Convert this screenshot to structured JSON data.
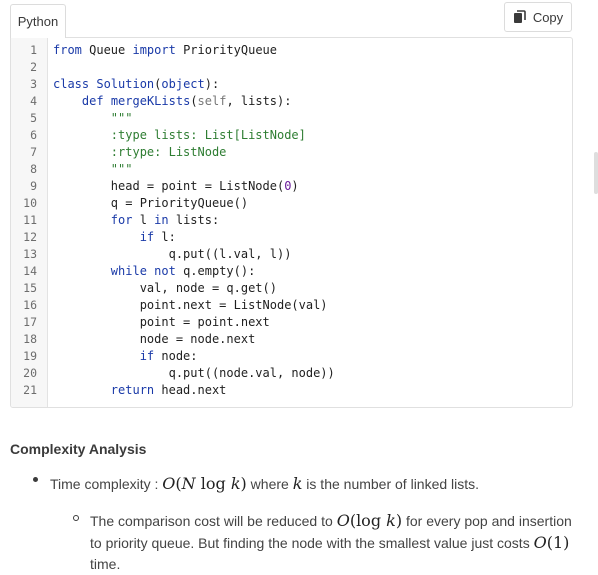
{
  "tab": {
    "label": "Python"
  },
  "copy": {
    "label": "Copy"
  },
  "code": {
    "line_numbers": [
      "1",
      "2",
      "3",
      "4",
      "5",
      "6",
      "7",
      "8",
      "9",
      "10",
      "11",
      "12",
      "13",
      "14",
      "15",
      "16",
      "17",
      "18",
      "19",
      "20",
      "21"
    ],
    "lines": [
      [
        {
          "t": "from",
          "c": "kw"
        },
        {
          "t": " Queue "
        },
        {
          "t": "import",
          "c": "kw"
        },
        {
          "t": " PriorityQueue"
        }
      ],
      [],
      [
        {
          "t": "class",
          "c": "kw"
        },
        {
          "t": " "
        },
        {
          "t": "Solution",
          "c": "kw"
        },
        {
          "t": "("
        },
        {
          "t": "object",
          "c": "kw"
        },
        {
          "t": "):"
        }
      ],
      [
        {
          "t": "    "
        },
        {
          "t": "def",
          "c": "kw"
        },
        {
          "t": " "
        },
        {
          "t": "mergeKLists",
          "c": "kw"
        },
        {
          "t": "("
        },
        {
          "t": "self",
          "c": "slf"
        },
        {
          "t": ", lists):"
        }
      ],
      [
        {
          "t": "        "
        },
        {
          "t": "\"\"\"",
          "c": "str"
        }
      ],
      [
        {
          "t": "        "
        },
        {
          "t": ":type lists: List[ListNode]",
          "c": "str"
        }
      ],
      [
        {
          "t": "        "
        },
        {
          "t": ":rtype: ListNode",
          "c": "str"
        }
      ],
      [
        {
          "t": "        "
        },
        {
          "t": "\"\"\"",
          "c": "str"
        }
      ],
      [
        {
          "t": "        head = point = ListNode("
        },
        {
          "t": "0",
          "c": "num"
        },
        {
          "t": ")"
        }
      ],
      [
        {
          "t": "        q = PriorityQueue()"
        }
      ],
      [
        {
          "t": "        "
        },
        {
          "t": "for",
          "c": "kw"
        },
        {
          "t": " l "
        },
        {
          "t": "in",
          "c": "kw"
        },
        {
          "t": " lists:"
        }
      ],
      [
        {
          "t": "            "
        },
        {
          "t": "if",
          "c": "kw"
        },
        {
          "t": " l:"
        }
      ],
      [
        {
          "t": "                q.put((l.val, l))"
        }
      ],
      [
        {
          "t": "        "
        },
        {
          "t": "while",
          "c": "kw"
        },
        {
          "t": " "
        },
        {
          "t": "not",
          "c": "kw"
        },
        {
          "t": " q.empty():"
        }
      ],
      [
        {
          "t": "            val, node = q.get()"
        }
      ],
      [
        {
          "t": "            point.next = ListNode(val)"
        }
      ],
      [
        {
          "t": "            point = point.next"
        }
      ],
      [
        {
          "t": "            node = node.next"
        }
      ],
      [
        {
          "t": "            "
        },
        {
          "t": "if",
          "c": "kw"
        },
        {
          "t": " node:"
        }
      ],
      [
        {
          "t": "                q.put((node.val, node))"
        }
      ],
      [
        {
          "t": "        "
        },
        {
          "t": "return",
          "c": "kw"
        },
        {
          "t": " head.next"
        }
      ]
    ]
  },
  "analysis": {
    "heading": "Complexity Analysis",
    "bullet1": {
      "prefix": "Time complexity : ",
      "math1": "O(N log k)",
      "middle": " where ",
      "math2": "k",
      "suffix": " is the number of linked lists."
    },
    "bullet2": {
      "text1": "The comparison cost will be reduced to ",
      "math1": "O(log k)",
      "text2": " for every pop and insertion to priority queue. But finding the node with the smallest value just costs ",
      "math2": "O(1)",
      "text3": " time."
    }
  },
  "icons": {
    "copy": "copy-icon"
  }
}
